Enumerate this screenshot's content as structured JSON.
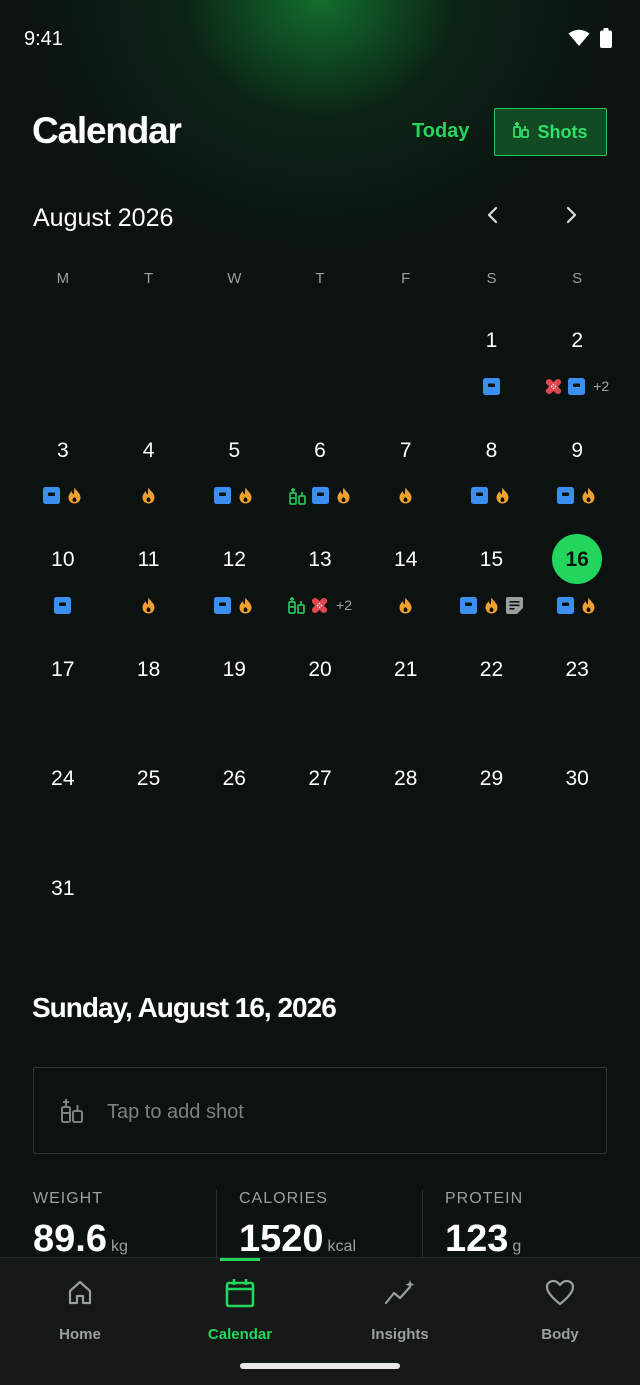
{
  "status_bar": {
    "time": "9:41"
  },
  "header": {
    "title": "Calendar",
    "today_label": "Today",
    "shots_label": "Shots"
  },
  "calendar": {
    "month_label": "August 2026",
    "weekdays": [
      "M",
      "T",
      "W",
      "T",
      "F",
      "S",
      "S"
    ],
    "weeks": [
      [
        null,
        null,
        null,
        null,
        null,
        {
          "day": 1,
          "ind": [
            "scale"
          ]
        },
        {
          "day": 2,
          "ind": [
            "bandage",
            "scale"
          ],
          "more": "+2"
        }
      ],
      [
        {
          "day": 3,
          "ind": [
            "scale",
            "flame"
          ]
        },
        {
          "day": 4,
          "ind": [
            "flame"
          ]
        },
        {
          "day": 5,
          "ind": [
            "scale",
            "flame"
          ]
        },
        {
          "day": 6,
          "ind": [
            "syringe",
            "scale",
            "flame"
          ]
        },
        {
          "day": 7,
          "ind": [
            "flame"
          ]
        },
        {
          "day": 8,
          "ind": [
            "scale",
            "flame"
          ]
        },
        {
          "day": 9,
          "ind": [
            "scale",
            "flame"
          ]
        }
      ],
      [
        {
          "day": 10,
          "ind": [
            "scale"
          ]
        },
        {
          "day": 11,
          "ind": [
            "flame"
          ]
        },
        {
          "day": 12,
          "ind": [
            "scale",
            "flame"
          ]
        },
        {
          "day": 13,
          "ind": [
            "syringe",
            "bandage"
          ],
          "more": "+2"
        },
        {
          "day": 14,
          "ind": [
            "flame"
          ]
        },
        {
          "day": 15,
          "ind": [
            "scale",
            "flame",
            "note"
          ]
        },
        {
          "day": 16,
          "ind": [
            "scale",
            "flame"
          ],
          "today": true
        }
      ],
      [
        {
          "day": 17,
          "ind": []
        },
        {
          "day": 18,
          "ind": []
        },
        {
          "day": 19,
          "ind": []
        },
        {
          "day": 20,
          "ind": []
        },
        {
          "day": 21,
          "ind": []
        },
        {
          "day": 22,
          "ind": []
        },
        {
          "day": 23,
          "ind": []
        }
      ],
      [
        {
          "day": 24,
          "ind": []
        },
        {
          "day": 25,
          "ind": []
        },
        {
          "day": 26,
          "ind": []
        },
        {
          "day": 27,
          "ind": []
        },
        {
          "day": 28,
          "ind": []
        },
        {
          "day": 29,
          "ind": []
        },
        {
          "day": 30,
          "ind": []
        }
      ],
      [
        {
          "day": 31,
          "ind": []
        },
        null,
        null,
        null,
        null,
        null,
        null
      ]
    ]
  },
  "selected": {
    "date_label": "Sunday, August 16, 2026",
    "add_shot_placeholder": "Tap to add shot"
  },
  "stats": [
    {
      "label": "WEIGHT",
      "value": "89.6",
      "unit": "kg"
    },
    {
      "label": "CALORIES",
      "value": "1520",
      "unit": "kcal"
    },
    {
      "label": "PROTEIN",
      "value": "123",
      "unit": "g"
    }
  ],
  "tabs": [
    {
      "label": "Home",
      "icon": "home-icon"
    },
    {
      "label": "Calendar",
      "icon": "calendar-icon",
      "active": true
    },
    {
      "label": "Insights",
      "icon": "insights-icon"
    },
    {
      "label": "Body",
      "icon": "heart-icon"
    }
  ],
  "colors": {
    "accent": "#22d65e",
    "scale": "#3b8ff0",
    "flame": "#f0a030",
    "bandage": "#e04850",
    "syringe": "#22c55e",
    "note": "#9aa09c"
  }
}
